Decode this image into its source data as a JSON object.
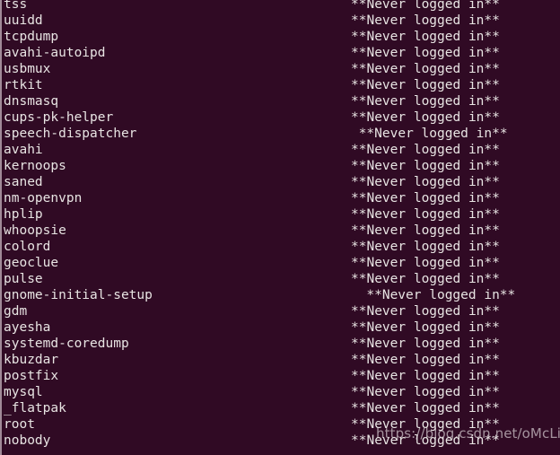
{
  "terminal": {
    "command_output_kind": "lastlog",
    "background_color": "#300a24",
    "foreground_color": "#e8e4e3",
    "never_logged_in_text": "**Never logged in**",
    "value_column_x": 389,
    "char_width": 8.7,
    "rows": [
      {
        "user": "tss",
        "value": "**Never logged in**",
        "indent": 0
      },
      {
        "user": "uuidd",
        "value": "**Never logged in**",
        "indent": 0
      },
      {
        "user": "tcpdump",
        "value": "**Never logged in**",
        "indent": 0
      },
      {
        "user": "avahi-autoipd",
        "value": "**Never logged in**",
        "indent": 0
      },
      {
        "user": "usbmux",
        "value": "**Never logged in**",
        "indent": 0
      },
      {
        "user": "rtkit",
        "value": "**Never logged in**",
        "indent": 0
      },
      {
        "user": "dnsmasq",
        "value": "**Never logged in**",
        "indent": 0
      },
      {
        "user": "cups-pk-helper",
        "value": "**Never logged in**",
        "indent": 0
      },
      {
        "user": "speech-dispatcher",
        "value": "**Never logged in**",
        "indent": 1
      },
      {
        "user": "avahi",
        "value": "**Never logged in**",
        "indent": 0
      },
      {
        "user": "kernoops",
        "value": "**Never logged in**",
        "indent": 0
      },
      {
        "user": "saned",
        "value": "**Never logged in**",
        "indent": 0
      },
      {
        "user": "nm-openvpn",
        "value": "**Never logged in**",
        "indent": 0
      },
      {
        "user": "hplip",
        "value": "**Never logged in**",
        "indent": 0
      },
      {
        "user": "whoopsie",
        "value": "**Never logged in**",
        "indent": 0
      },
      {
        "user": "colord",
        "value": "**Never logged in**",
        "indent": 0
      },
      {
        "user": "geoclue",
        "value": "**Never logged in**",
        "indent": 0
      },
      {
        "user": "pulse",
        "value": "**Never logged in**",
        "indent": 0
      },
      {
        "user": "gnome-initial-setup",
        "value": "**Never logged in**",
        "indent": 2
      },
      {
        "user": "gdm",
        "value": "**Never logged in**",
        "indent": 0
      },
      {
        "user": "ayesha",
        "value": "**Never logged in**",
        "indent": 0
      },
      {
        "user": "systemd-coredump",
        "value": "**Never logged in**",
        "indent": 0
      },
      {
        "user": "kbuzdar",
        "value": "**Never logged in**",
        "indent": 0
      },
      {
        "user": "postfix",
        "value": "**Never logged in**",
        "indent": 0
      },
      {
        "user": "mysql",
        "value": "**Never logged in**",
        "indent": 0
      },
      {
        "user": "_flatpak",
        "value": "**Never logged in**",
        "indent": 0
      },
      {
        "user": "root",
        "value": "**Never logged in**",
        "indent": 0
      },
      {
        "user": "nobody",
        "value": "**Never logged in**",
        "indent": 0
      }
    ]
  },
  "watermark": {
    "text": "https://blog.csdn.net/oMcLin"
  }
}
